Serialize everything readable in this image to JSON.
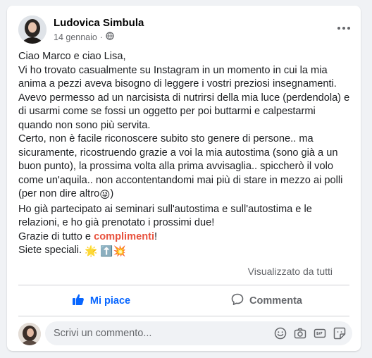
{
  "post": {
    "author": "Ludovica Simbula",
    "date": "14 gennaio",
    "separator": "·",
    "privacy_icon": "globe-icon",
    "more_icon": "more-options-icon",
    "lines": [
      "Ciao Marco e ciao Lisa,",
      "Vi ho trovato casualmente su Instagram in un momento in cui la mia anima a pezzi aveva bisogno di leggere i vostri preziosi insegnamenti.",
      "Avevo permesso ad un narcisista di nutrirsi della mia luce (perdendola) e di usarmi come se fossi un oggetto per poi buttarmi e calpestarmi quando non sono più servita.",
      "Certo, non è facile riconoscere subito sto genere di persone.. ma sicuramente, ricostruendo grazie a voi la mia autostima (sono già a un buon punto), la prossima volta alla prima avvisaglia.. spiccherò il volo come un'aquila.. non accontentandomi mai più di stare in mezzo ai polli (per non dire altro",
      ")",
      "Ho già partecipato ai seminari sull'autostima e sull'autostima e le relazioni, e ho già prenotato i prossimi due!",
      "Grazie di tutto e ",
      "complimenti",
      "!",
      "Siete speciali. "
    ],
    "emoji_laugh": "😜",
    "emoji_tail": "🌟 ⬆️💥",
    "seen_by": "Visualizzato da tutti"
  },
  "actions": {
    "like_label": "Mi piace",
    "comment_label": "Commenta"
  },
  "comment_box": {
    "placeholder": "Scrivi un commento...",
    "icons": [
      "emoji-icon",
      "camera-icon",
      "gif-icon",
      "sticker-icon"
    ]
  },
  "colors": {
    "accent": "#0866ff",
    "highlight": "#e8533f",
    "muted": "#65676b"
  }
}
